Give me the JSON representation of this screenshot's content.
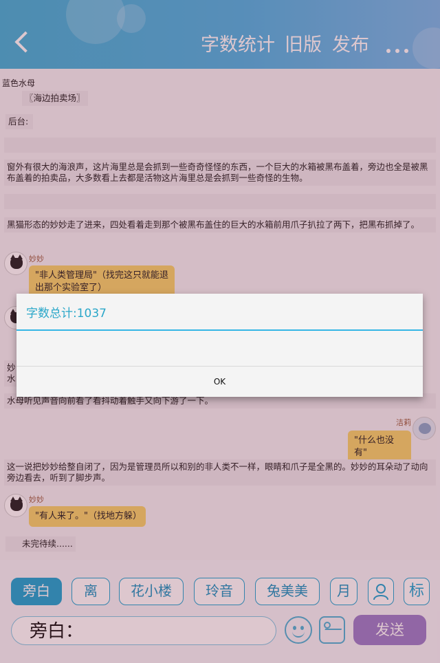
{
  "header": {
    "word_count_label": "字数统计",
    "old_version_label": "旧版",
    "publish_label": "发布"
  },
  "chat": {
    "author": "蓝色水母",
    "scene": "〖海边拍卖场〗",
    "backstage": "后台:",
    "narration_1": "窗外有很大的海浪声，这片海里总是会抓到一些奇奇怪怪的东西，一个巨大的水箱被黑布盖着，旁边也全是被黑布盖着的拍卖品，大多数看上去都是活物这片海里总是会抓到一些奇怪的生物。",
    "narration_2": "黑猫形态的妙妙走了进来，四处看着走到那个被黑布盖住的巨大的水箱前用爪子扒拉了两下，把黑布抓掉了。",
    "msg_1_speaker": "妙妙",
    "msg_1_text": "\"非人类管理局\"（找完这只就能退出那个实验室了）",
    "partial_1": "妙",
    "partial_2": "水",
    "narration_3": "水母听见声音向前看了看抖动着触手又向下游了一下。",
    "msg_2_speaker": "洁莉",
    "msg_2_text": "\"什么也没有\"",
    "narration_4": "这一说把妙妙给整自闭了，因为是管理员所以和别的非人类不一样，眼睛和爪子是全黑的。妙妙的耳朵动了动向旁边看去，听到了脚步声。",
    "msg_3_speaker": "妙妙",
    "msg_3_text": "\"有人来了。\"（找地方躲）",
    "to_be_continued": "未完待续......"
  },
  "roles": [
    {
      "label": "旁白"
    },
    {
      "label": "离"
    },
    {
      "label": "花小楼"
    },
    {
      "label": "玲音"
    },
    {
      "label": "兔美美"
    },
    {
      "label": "月"
    }
  ],
  "role_icon_2_label": "标",
  "input": {
    "prefix": "旁白："
  },
  "send_label": "发送",
  "dialog": {
    "title": "字数总计:1037",
    "ok_label": "OK"
  }
}
